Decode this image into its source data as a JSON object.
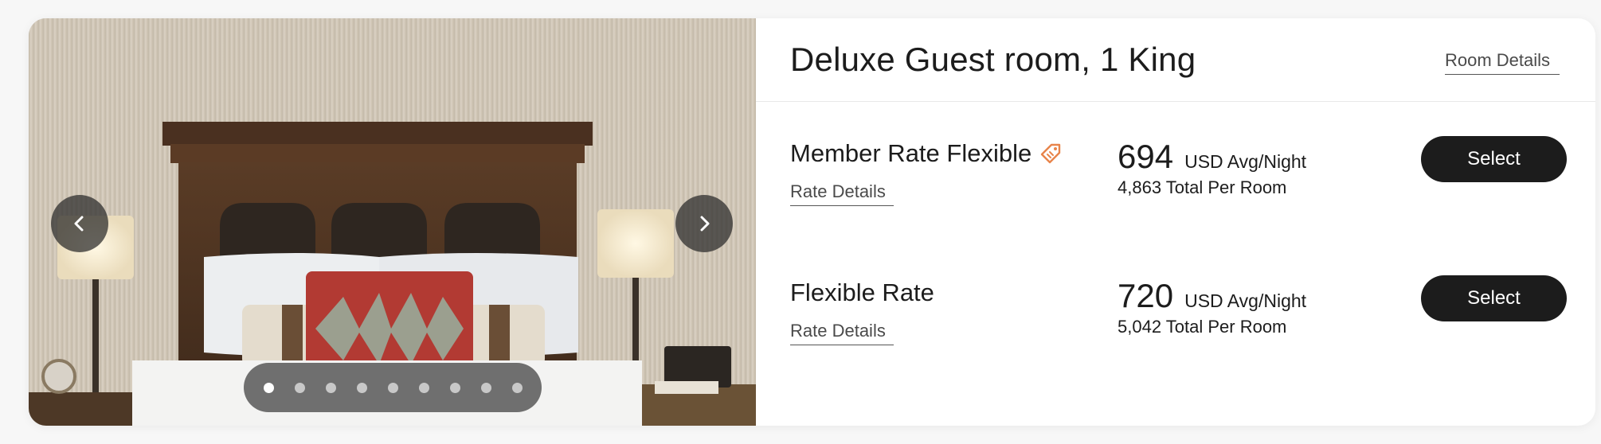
{
  "room": {
    "title": "Deluxe Guest room, 1 King",
    "details_link": "Room Details"
  },
  "carousel": {
    "prev_icon": "chevron-left-icon",
    "next_icon": "chevron-right-icon",
    "total_slides": 9,
    "active_slide": 1
  },
  "rates": [
    {
      "name": "Member Rate Flexible",
      "badge_icon": "tag-icon",
      "details_link": "Rate Details",
      "amount": "694",
      "unit": "USD Avg/Night",
      "total": "4,863 Total Per Room",
      "select_label": "Select"
    },
    {
      "name": "Flexible Rate",
      "details_link": "Rate Details",
      "amount": "720",
      "unit": "USD Avg/Night",
      "total": "5,042 Total Per Room",
      "select_label": "Select"
    }
  ],
  "colors": {
    "button_bg": "#1c1c1c",
    "member_tag": "#e8844a"
  }
}
